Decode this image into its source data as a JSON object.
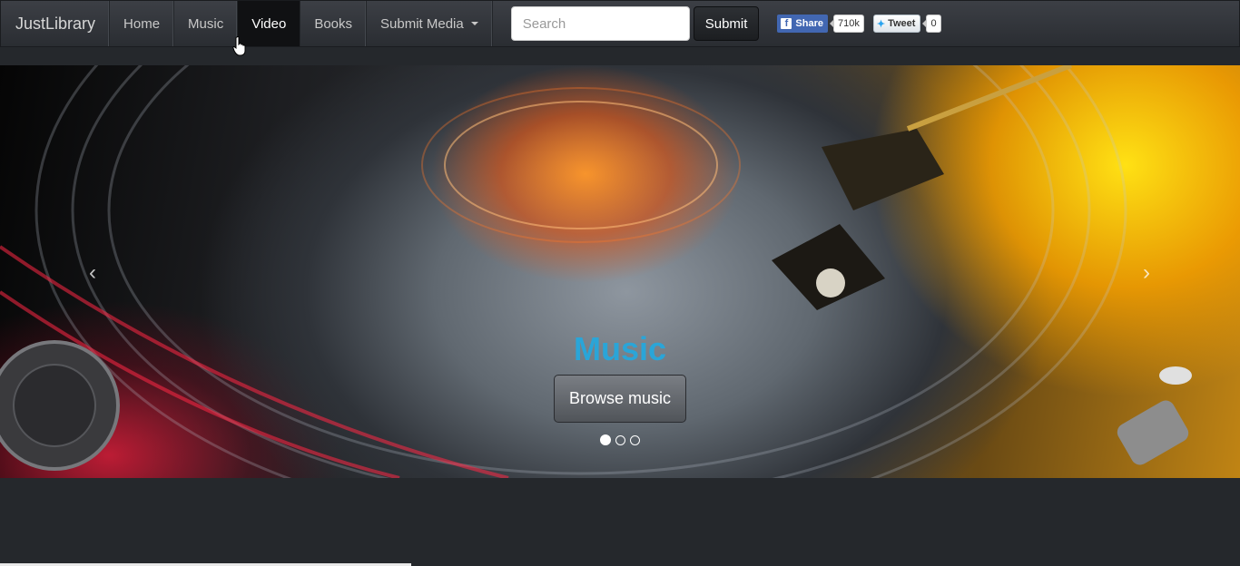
{
  "navbar": {
    "brand": "JustLibrary",
    "items": [
      {
        "label": "Home"
      },
      {
        "label": "Music"
      },
      {
        "label": "Video",
        "active": true
      },
      {
        "label": "Books"
      },
      {
        "label": "Submit Media",
        "dropdown": true
      }
    ],
    "search": {
      "placeholder": "Search",
      "value": ""
    },
    "submit_label": "Submit",
    "social": {
      "facebook": {
        "label": "Share",
        "count": "710k"
      },
      "twitter": {
        "label": "Tweet",
        "count": "0"
      }
    }
  },
  "carousel": {
    "caption_title": "Music",
    "button_label": "Browse music",
    "prev_icon": "‹",
    "next_icon": "›",
    "slides_count": 3,
    "active_slide": 0,
    "image": "turntable with glowing record and stylus"
  },
  "colors": {
    "navbar_bg": "#34373c",
    "active_nav_bg": "#101113",
    "caption_color": "#2aa5d8",
    "page_bg": "#25282c",
    "facebook_blue": "#4267b2",
    "twitter_blue": "#2aa3ef"
  }
}
